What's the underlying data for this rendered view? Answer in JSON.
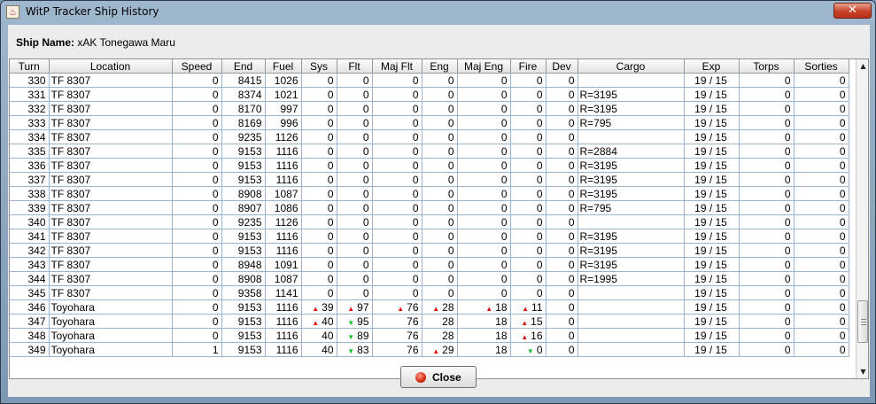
{
  "window": {
    "title": "WitP Tracker Ship History",
    "close_glyph": "✕"
  },
  "ship": {
    "label": "Ship Name:",
    "value": "xAK Tonegawa Maru"
  },
  "columns": [
    "Turn",
    "Location",
    "Speed",
    "End",
    "Fuel",
    "Sys",
    "Flt",
    "Maj Flt",
    "Eng",
    "Maj Eng",
    "Fire",
    "Dev",
    "Cargo",
    "Exp",
    "Torps",
    "Sorties"
  ],
  "rows": [
    [
      "330",
      "TF 8307",
      "0",
      "8415",
      "1026",
      "0",
      "0",
      "0",
      "0",
      "0",
      "0",
      "0",
      "",
      "19 / 15",
      "0",
      "0"
    ],
    [
      "331",
      "TF 8307",
      "0",
      "8374",
      "1021",
      "0",
      "0",
      "0",
      "0",
      "0",
      "0",
      "0",
      "R=3195",
      "19 / 15",
      "0",
      "0"
    ],
    [
      "332",
      "TF 8307",
      "0",
      "8170",
      "997",
      "0",
      "0",
      "0",
      "0",
      "0",
      "0",
      "0",
      "R=3195",
      "19 / 15",
      "0",
      "0"
    ],
    [
      "333",
      "TF 8307",
      "0",
      "8169",
      "996",
      "0",
      "0",
      "0",
      "0",
      "0",
      "0",
      "0",
      "R=795",
      "19 / 15",
      "0",
      "0"
    ],
    [
      "334",
      "TF 8307",
      "0",
      "9235",
      "1126",
      "0",
      "0",
      "0",
      "0",
      "0",
      "0",
      "0",
      "",
      "19 / 15",
      "0",
      "0"
    ],
    [
      "335",
      "TF 8307",
      "0",
      "9153",
      "1116",
      "0",
      "0",
      "0",
      "0",
      "0",
      "0",
      "0",
      "R=2884",
      "19 / 15",
      "0",
      "0"
    ],
    [
      "336",
      "TF 8307",
      "0",
      "9153",
      "1116",
      "0",
      "0",
      "0",
      "0",
      "0",
      "0",
      "0",
      "R=3195",
      "19 / 15",
      "0",
      "0"
    ],
    [
      "337",
      "TF 8307",
      "0",
      "9153",
      "1116",
      "0",
      "0",
      "0",
      "0",
      "0",
      "0",
      "0",
      "R=3195",
      "19 / 15",
      "0",
      "0"
    ],
    [
      "338",
      "TF 8307",
      "0",
      "8908",
      "1087",
      "0",
      "0",
      "0",
      "0",
      "0",
      "0",
      "0",
      "R=3195",
      "19 / 15",
      "0",
      "0"
    ],
    [
      "339",
      "TF 8307",
      "0",
      "8907",
      "1086",
      "0",
      "0",
      "0",
      "0",
      "0",
      "0",
      "0",
      "R=795",
      "19 / 15",
      "0",
      "0"
    ],
    [
      "340",
      "TF 8307",
      "0",
      "9235",
      "1126",
      "0",
      "0",
      "0",
      "0",
      "0",
      "0",
      "0",
      "",
      "19 / 15",
      "0",
      "0"
    ],
    [
      "341",
      "TF 8307",
      "0",
      "9153",
      "1116",
      "0",
      "0",
      "0",
      "0",
      "0",
      "0",
      "0",
      "R=3195",
      "19 / 15",
      "0",
      "0"
    ],
    [
      "342",
      "TF 8307",
      "0",
      "9153",
      "1116",
      "0",
      "0",
      "0",
      "0",
      "0",
      "0",
      "0",
      "R=3195",
      "19 / 15",
      "0",
      "0"
    ],
    [
      "343",
      "TF 8307",
      "0",
      "8948",
      "1091",
      "0",
      "0",
      "0",
      "0",
      "0",
      "0",
      "0",
      "R=3195",
      "19 / 15",
      "0",
      "0"
    ],
    [
      "344",
      "TF 8307",
      "0",
      "8908",
      "1087",
      "0",
      "0",
      "0",
      "0",
      "0",
      "0",
      "0",
      "R=1995",
      "19 / 15",
      "0",
      "0"
    ],
    [
      "345",
      "TF 8307",
      "0",
      "9358",
      "1141",
      "0",
      "0",
      "0",
      "0",
      "0",
      "0",
      "0",
      "",
      "19 / 15",
      "0",
      "0"
    ],
    [
      "346",
      "Toyohara",
      "0",
      "9153",
      "1116",
      "▲ 39",
      "▲ 97",
      "▲ 76",
      "▲ 28",
      "▲ 18",
      "▲ 11",
      "0",
      "",
      "19 / 15",
      "0",
      "0"
    ],
    [
      "347",
      "Toyohara",
      "0",
      "9153",
      "1116",
      "▲ 40",
      "▼ 95",
      "76",
      "28",
      "18",
      "▲ 15",
      "0",
      "",
      "19 / 15",
      "0",
      "0"
    ],
    [
      "348",
      "Toyohara",
      "0",
      "9153",
      "1116",
      "40",
      "▼ 89",
      "76",
      "28",
      "18",
      "▲ 16",
      "0",
      "",
      "19 / 15",
      "0",
      "0"
    ],
    [
      "349",
      "Toyohara",
      "1",
      "9153",
      "1116",
      "40",
      "▼ 83",
      "76",
      "▲ 29",
      "18",
      "▼ 0",
      "0",
      "",
      "19 / 15",
      "0",
      "0"
    ]
  ],
  "scrollbar": {
    "up_icon": "▲",
    "down_icon": "▼"
  },
  "buttons": {
    "close": "Close"
  },
  "colors": {
    "trend_up": "#e01010",
    "trend_down": "#18c02a",
    "row_grid": "#9bb4d6"
  }
}
